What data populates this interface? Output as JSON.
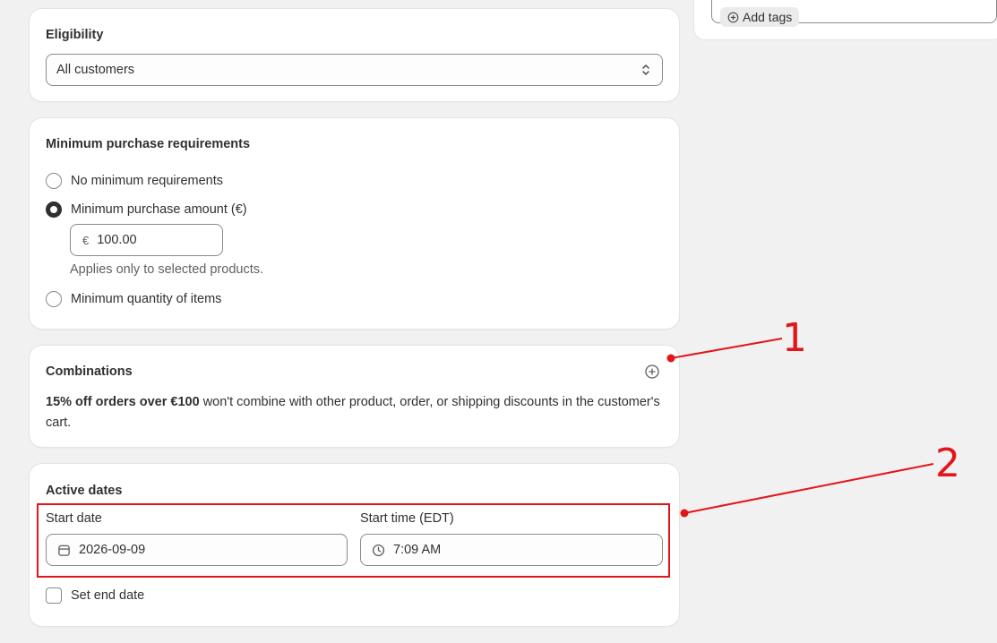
{
  "side": {
    "add_tags_label": "Add tags"
  },
  "eligibility": {
    "title": "Eligibility",
    "selected": "All customers"
  },
  "min_purchase": {
    "title": "Minimum purchase requirements",
    "options": [
      {
        "label": "No minimum requirements",
        "checked": false
      },
      {
        "label": "Minimum purchase amount (€)",
        "checked": true
      },
      {
        "label": "Minimum quantity of items",
        "checked": false
      }
    ],
    "currency_symbol": "€",
    "amount": "100.00",
    "help": "Applies only to selected products."
  },
  "combinations": {
    "title": "Combinations",
    "bold": "15% off orders over €100",
    "rest": " won't combine with other product, order, or shipping discounts in the customer's cart."
  },
  "active_dates": {
    "title": "Active dates",
    "start_date_label": "Start date",
    "start_date": "2026-09-09",
    "start_time_label": "Start time (EDT)",
    "start_time": "7:09 AM",
    "end_date_label": "Set end date"
  },
  "annotations": {
    "one": "1",
    "two": "2",
    "color": "#e4151a"
  }
}
